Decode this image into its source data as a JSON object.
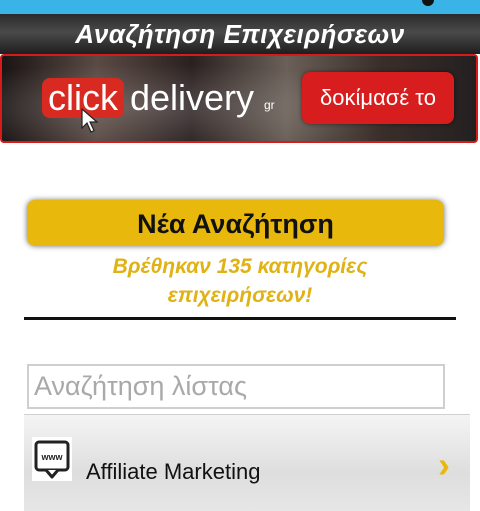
{
  "header": {
    "title": "Αναζήτηση Επιχειρήσεων"
  },
  "banner": {
    "brand_click": "click",
    "brand_delivery": "delivery",
    "brand_gr": "gr",
    "cta": "δοκίμασέ το"
  },
  "search": {
    "new_search_label": "Νέα Αναζήτηση",
    "found_text": "Βρέθηκαν 135 κατηγορίες επιχειρήσεων!",
    "list_placeholder": "Αναζήτηση λίστας"
  },
  "list": {
    "items": [
      {
        "label": "Affiliate Marketing",
        "icon": "www-icon"
      }
    ]
  },
  "colors": {
    "accent": "#e8b90c",
    "brand_red": "#d71d1d",
    "status_bar": "#3ab3e6"
  }
}
